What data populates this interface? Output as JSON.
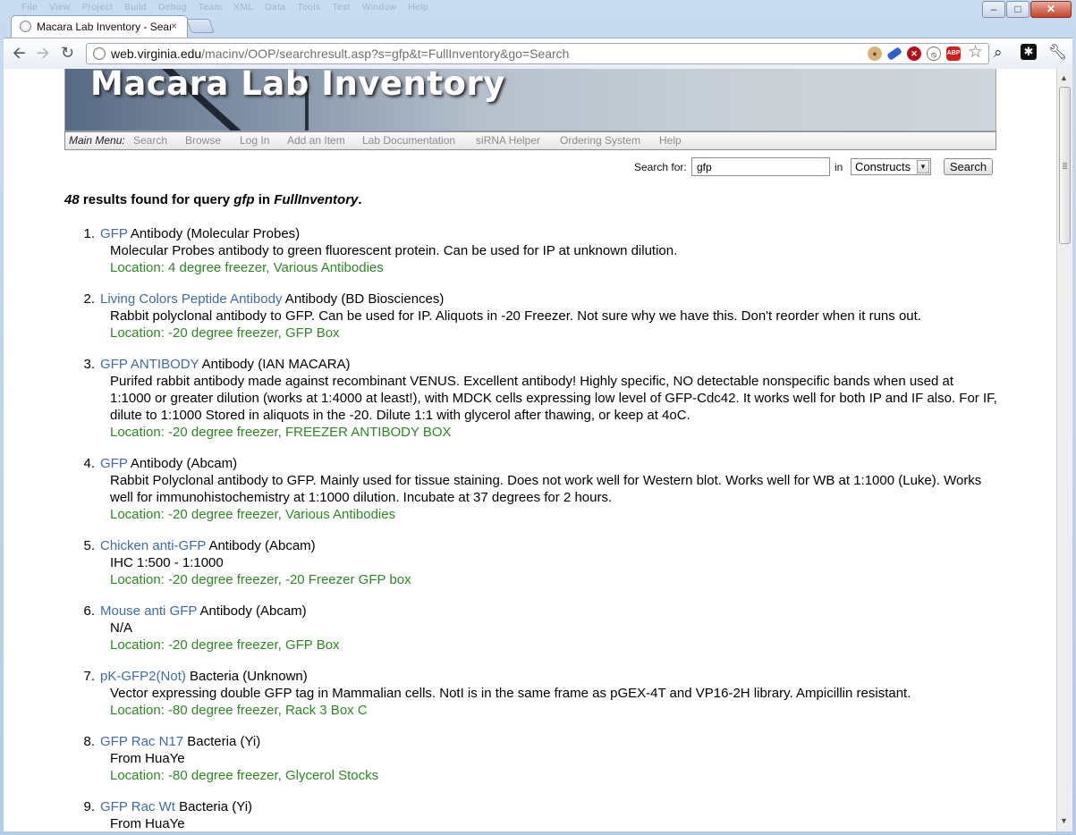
{
  "window": {
    "ghost_menu": [
      "File",
      "View",
      "Project",
      "Build",
      "Debug",
      "Team",
      "XML",
      "Data",
      "Tools",
      "Test",
      "Window",
      "Help"
    ]
  },
  "tab": {
    "title": "Macara Lab Inventory - Sear",
    "close": "×"
  },
  "toolbar": {
    "url_host": "web.virginia.edu",
    "url_path": "/macinv/OOP/searchresult.asp?s=gfp&t=FullInventory&go=Search"
  },
  "page": {
    "banner_title": "Macara Lab Inventory",
    "main_menu_label": "Main Menu:",
    "menu_items": [
      "Search",
      "Browse",
      "Log In",
      "Add an Item",
      "Lab Documentation",
      "siRNA Helper",
      "Ordering System",
      "Help"
    ],
    "search": {
      "label": "Search for:",
      "value": "gfp",
      "in_label": "in",
      "scope": "Constructs",
      "button": "Search"
    },
    "summary": {
      "count": "48",
      "text1": " results found for query ",
      "query": "gfp",
      "text2": " in ",
      "table": "FullInventory",
      "text3": "."
    },
    "results": [
      {
        "num": "1.",
        "name": "GFP",
        "type": " Antibody (Molecular Probes)",
        "desc": "Molecular Probes antibody to green fluorescent protein. Can be used for IP at unknown dilution.",
        "location": "Location: 4 degree freezer, Various Antibodies"
      },
      {
        "num": "2.",
        "name": "Living Colors Peptide Antibody",
        "type": " Antibody (BD Biosciences)",
        "desc": "Rabbit polyclonal antibody to GFP. Can be used for IP. Aliquots in -20 Freezer. Not sure why we have this. Don't reorder when it runs out.",
        "location": "Location: -20 degree freezer, GFP Box"
      },
      {
        "num": "3.",
        "name": "GFP ANTIBODY",
        "type": " Antibody (IAN MACARA)",
        "desc": "Purifed rabbit antibody made against recombinant VENUS. Excellent antibody! Highly specific, NO detectable nonspecific bands when used at 1:1000 or greater dilution (works at 1:4000 at least!), with MDCK cells expressing low level of GFP-Cdc42. It works well for both IP and IF also. For IF, dilute to 1:1000 Stored in aliquots in the -20. Dilute 1:1 with glycerol after thawing, or keep at 4oC.",
        "location": "Location: -20 degree freezer, FREEZER ANTIBODY BOX"
      },
      {
        "num": "4.",
        "name": "GFP",
        "type": " Antibody (Abcam)",
        "desc": "Rabbit Polyclonal antibody to GFP. Mainly used for tissue staining. Does not work well for Western blot. Works well for WB at 1:1000 (Luke). Works well for immunohistochemistry at 1:1000 dilution. Incubate at 37 degrees for 2 hours.",
        "location": "Location: -20 degree freezer, Various Antibodies"
      },
      {
        "num": "5.",
        "name": "Chicken anti-GFP",
        "type": " Antibody (Abcam)",
        "desc": "IHC 1:500 - 1:1000",
        "location": "Location: -20 degree freezer, -20 Freezer GFP box"
      },
      {
        "num": "6.",
        "name": "Mouse anti GFP",
        "type": " Antibody (Abcam)",
        "desc": "N/A",
        "location": "Location: -20 degree freezer, GFP Box"
      },
      {
        "num": "7.",
        "name": "pK-GFP2(Not)",
        "type": " Bacteria (Unknown)",
        "desc": "Vector expressing double GFP tag in Mammalian cells. NotI is in the same frame as pGEX-4T and VP16-2H library. Ampicillin resistant.",
        "location": "Location: -80 degree freezer, Rack 3 Box C"
      },
      {
        "num": "8.",
        "name": "GFP Rac N17",
        "type": " Bacteria (Yi)",
        "desc": "From HuaYe",
        "location": "Location: -80 degree freezer, Glycerol Stocks"
      },
      {
        "num": "9.",
        "name": "GFP Rac Wt",
        "type": " Bacteria (Yi)",
        "desc": "From HuaYe",
        "location": ""
      }
    ]
  }
}
